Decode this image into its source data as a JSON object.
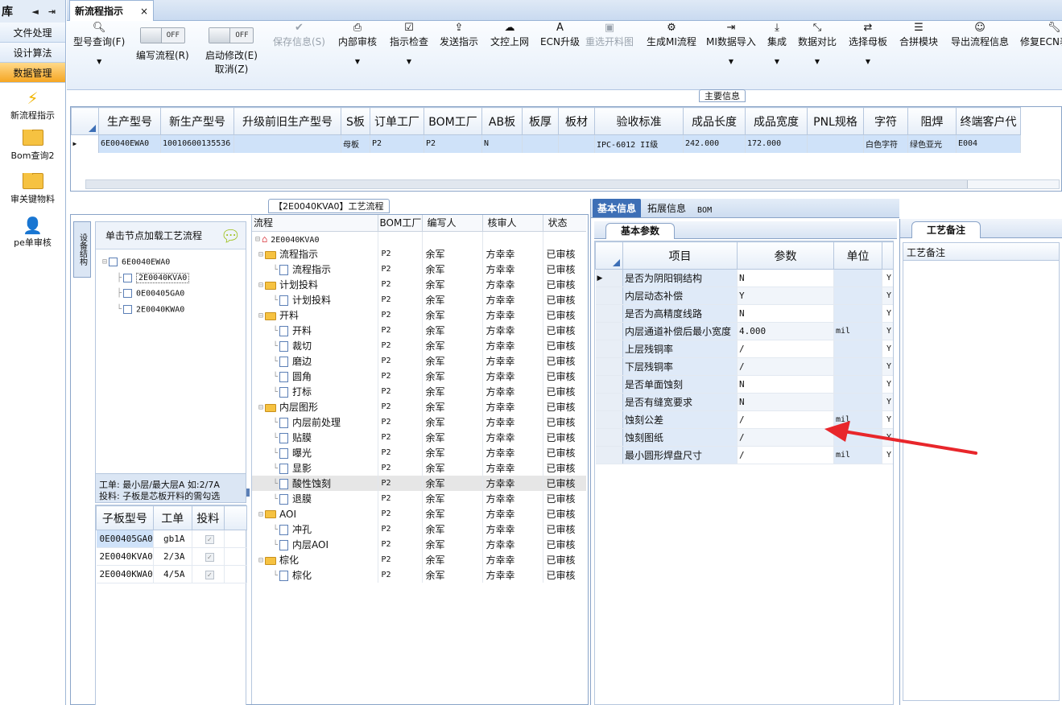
{
  "left": {
    "title": "库",
    "nav_left": "◄",
    "nav_right": "⇥",
    "menus": [
      "文件处理",
      "设计算法",
      "数据管理"
    ],
    "items": [
      "新流程指示",
      "Bom查询2",
      "审关键物料",
      "pe单审核"
    ]
  },
  "tabbar": {
    "tab_label": "新流程指示",
    "close": "×"
  },
  "toolbar": {
    "query": "型号查询(F)",
    "edit_flow": "编写流程(R)",
    "toggle_off": "OFF",
    "start_edit_1": "启动修改(E)",
    "start_edit_2": "取消(Z)",
    "save": "保存信息(S)",
    "inner_review": "内部审核",
    "check": "指示检查",
    "send": "发送指示",
    "upload": "文控上网",
    "ecn": "ECN升级",
    "reselect": "重选开料图",
    "gen_mi": "生成MI流程",
    "mi_import": "MI数据导入",
    "integrate": "集成",
    "compare": "数据对比",
    "select_master": "选择母板",
    "combine": "合拼模块",
    "export": "导出流程信息",
    "fix_ecn": "修复ECN表"
  },
  "main_info": {
    "label": "主要信息",
    "headers": [
      "生产型号",
      "新生产型号",
      "升级前旧生产型号",
      "S板",
      "订单工厂",
      "BOM工厂",
      "AB板",
      "板厚",
      "板材",
      "验收标准",
      "成品长度",
      "成品宽度",
      "PNL规格",
      "字符",
      "阻焊",
      "终端客户代"
    ],
    "row": [
      "6E0040EWA0",
      "10010600135536",
      "",
      "母板",
      "P2",
      "P2",
      "N",
      "",
      "",
      "IPC-6012 II级",
      "242.000",
      "172.000",
      "",
      "白色字符",
      "绿色亚光",
      "E004"
    ]
  },
  "process": {
    "title": "【2E0040KVA0】工艺流程",
    "side_tab": "设备结构",
    "hint": "单击节点加载工艺流程",
    "tree_root": "6E0040EWA0",
    "tree_children": [
      "2E0040KVA0",
      "0E00405GA0",
      "2E0040KWA0"
    ],
    "note1": "工单: 最小层/最大层A 如:2/7A",
    "note2": "投料: 子板是芯板开料的需勾选",
    "sub_headers": [
      "子板型号",
      "工单",
      "投料"
    ],
    "sub_rows": [
      {
        "model": "0E00405GA0",
        "order": "gb1A",
        "mark": "✓"
      },
      {
        "model": "2E0040KVA0",
        "order": "2/3A",
        "mark": "✓"
      },
      {
        "model": "2E0040KWA0",
        "order": "4/5A",
        "mark": "✓"
      }
    ],
    "flow_headers": [
      "流程",
      "BOM工厂",
      "编写人",
      "核审人",
      "状态"
    ],
    "flow_root": "2E0040KVA0",
    "flow_rows": [
      {
        "name": "流程指示",
        "group": true,
        "bom": "P2",
        "author": "余军",
        "reviewer": "方幸幸",
        "status": "已审核"
      },
      {
        "name": "流程指示",
        "group": false,
        "bom": "P2",
        "author": "余军",
        "reviewer": "方幸幸",
        "status": "已审核"
      },
      {
        "name": "计划投料",
        "group": true,
        "bom": "P2",
        "author": "余军",
        "reviewer": "方幸幸",
        "status": "已审核"
      },
      {
        "name": "计划投料",
        "group": false,
        "bom": "P2",
        "author": "余军",
        "reviewer": "方幸幸",
        "status": "已审核"
      },
      {
        "name": "开料",
        "group": true,
        "bom": "P2",
        "author": "余军",
        "reviewer": "方幸幸",
        "status": "已审核"
      },
      {
        "name": "开料",
        "group": false,
        "bom": "P2",
        "author": "余军",
        "reviewer": "方幸幸",
        "status": "已审核"
      },
      {
        "name": "裁切",
        "group": false,
        "bom": "P2",
        "author": "余军",
        "reviewer": "方幸幸",
        "status": "已审核"
      },
      {
        "name": "磨边",
        "group": false,
        "bom": "P2",
        "author": "余军",
        "reviewer": "方幸幸",
        "status": "已审核"
      },
      {
        "name": "圆角",
        "group": false,
        "bom": "P2",
        "author": "余军",
        "reviewer": "方幸幸",
        "status": "已审核"
      },
      {
        "name": "打标",
        "group": false,
        "bom": "P2",
        "author": "余军",
        "reviewer": "方幸幸",
        "status": "已审核"
      },
      {
        "name": "内层图形",
        "group": true,
        "bom": "P2",
        "author": "余军",
        "reviewer": "方幸幸",
        "status": "已审核"
      },
      {
        "name": "内层前处理",
        "group": false,
        "bom": "P2",
        "author": "余军",
        "reviewer": "方幸幸",
        "status": "已审核"
      },
      {
        "name": "贴膜",
        "group": false,
        "bom": "P2",
        "author": "余军",
        "reviewer": "方幸幸",
        "status": "已审核"
      },
      {
        "name": "曝光",
        "group": false,
        "bom": "P2",
        "author": "余军",
        "reviewer": "方幸幸",
        "status": "已审核"
      },
      {
        "name": "显影",
        "group": false,
        "bom": "P2",
        "author": "余军",
        "reviewer": "方幸幸",
        "status": "已审核"
      },
      {
        "name": "酸性蚀刻",
        "group": false,
        "bom": "P2",
        "author": "余军",
        "reviewer": "方幸幸",
        "status": "已审核",
        "selected": true
      },
      {
        "name": "退膜",
        "group": false,
        "bom": "P2",
        "author": "余军",
        "reviewer": "方幸幸",
        "status": "已审核"
      },
      {
        "name": "AOI",
        "group": true,
        "bom": "P2",
        "author": "余军",
        "reviewer": "方幸幸",
        "status": "已审核"
      },
      {
        "name": "冲孔",
        "group": false,
        "bom": "P2",
        "author": "余军",
        "reviewer": "方幸幸",
        "status": "已审核"
      },
      {
        "name": "内层AOI",
        "group": false,
        "bom": "P2",
        "author": "余军",
        "reviewer": "方幸幸",
        "status": "已审核"
      },
      {
        "name": "棕化",
        "group": true,
        "bom": "P2",
        "author": "余军",
        "reviewer": "方幸幸",
        "status": "已审核"
      },
      {
        "name": "棕化",
        "group": false,
        "bom": "P2",
        "author": "余军",
        "reviewer": "方幸幸",
        "status": "已审核"
      }
    ]
  },
  "info": {
    "tabs": [
      "基本信息",
      "拓展信息",
      "BOM"
    ],
    "sub_tab": "基本参数",
    "headers": [
      "项目",
      "参数",
      "单位"
    ],
    "rows": [
      {
        "item": "是否为阴阳铜结构",
        "value": "N",
        "unit": "",
        "flag": "Y"
      },
      {
        "item": "内层动态补偿",
        "value": "Y",
        "unit": "",
        "flag": "Y"
      },
      {
        "item": "是否为高精度线路",
        "value": "N",
        "unit": "",
        "flag": "Y"
      },
      {
        "item": "内层通道补偿后最小宽度",
        "value": "4.000",
        "unit": "mil",
        "flag": "Y"
      },
      {
        "item": "上层残铜率",
        "value": "/",
        "unit": "",
        "flag": "Y"
      },
      {
        "item": "下层残铜率",
        "value": "/",
        "unit": "",
        "flag": "Y"
      },
      {
        "item": "是否单面蚀刻",
        "value": "N",
        "unit": "",
        "flag": "Y"
      },
      {
        "item": "是否有缝宽要求",
        "value": "N",
        "unit": "",
        "flag": "Y"
      },
      {
        "item": "蚀刻公差",
        "value": "/",
        "unit": "mil",
        "flag": "Y"
      },
      {
        "item": "蚀刻图纸",
        "value": "/",
        "unit": "",
        "flag": "Y"
      },
      {
        "item": "最小圆形焊盘尺寸",
        "value": "/",
        "unit": "mil",
        "flag": "Y"
      }
    ]
  },
  "remark": {
    "tab": "工艺备注",
    "header": "工艺备注"
  },
  "colors": {
    "accent": "#3d6fb6",
    "arrow": "#e8262b",
    "selected_row": "#cfe2f9"
  }
}
